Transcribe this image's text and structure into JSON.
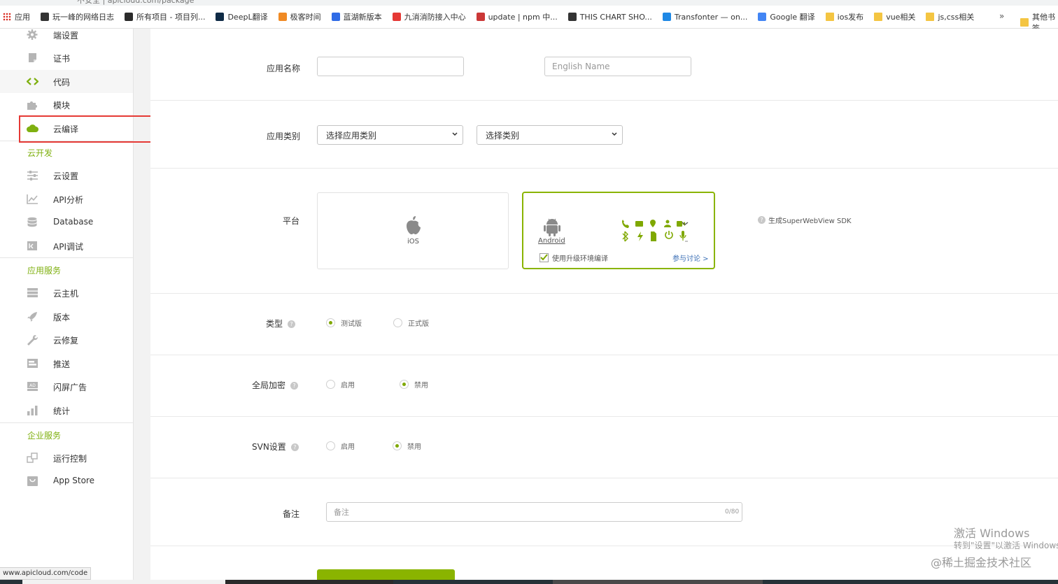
{
  "browser": {
    "url_fragment": "不安全 | apicloud.com/package",
    "bookmarks": [
      {
        "label": "应用",
        "icon": "apps-grid-icon",
        "color": "#d93025"
      },
      {
        "label": "玩一峰的网络日志",
        "icon": "ruanyifeng-favicon",
        "color": "#333333"
      },
      {
        "label": "所有项目 - 项目列...",
        "icon": "project-favicon",
        "color": "#2b2b2b"
      },
      {
        "label": "DeepL翻译",
        "icon": "deepl-favicon",
        "color": "#0f2b46"
      },
      {
        "label": "极客时间",
        "icon": "geektime-favicon",
        "color": "#f08a24"
      },
      {
        "label": "蓝湖新版本",
        "icon": "lanhu-favicon",
        "color": "#2f6be6"
      },
      {
        "label": "九消消防接入中心",
        "icon": "fire-favicon",
        "color": "#e53935"
      },
      {
        "label": "update | npm 中...",
        "icon": "npm-favicon",
        "color": "#cb3837"
      },
      {
        "label": "THIS CHART SHO...",
        "icon": "github-favicon",
        "color": "#333333"
      },
      {
        "label": "Transfonter — on...",
        "icon": "triangle-favicon",
        "color": "#1e88e5"
      },
      {
        "label": "Google 翻译",
        "icon": "google-translate-favicon",
        "color": "#4285f4"
      },
      {
        "label": "ios发布",
        "icon": "folder-icon",
        "color": "#f4c542"
      },
      {
        "label": "vue相关",
        "icon": "folder-icon",
        "color": "#f4c542"
      },
      {
        "label": "js,css相关",
        "icon": "folder-icon",
        "color": "#f4c542"
      }
    ],
    "more": "»",
    "other_bookmarks": "其他书签",
    "status_url": "www.apicloud.com/code"
  },
  "sidebar": {
    "items_top": [
      {
        "label": "端设置",
        "icon": "gear-icon"
      },
      {
        "label": "证书",
        "icon": "certificate-icon"
      },
      {
        "label": "代码",
        "icon": "code-icon"
      },
      {
        "label": "模块",
        "icon": "puzzle-icon"
      },
      {
        "label": "云编译",
        "icon": "cloud-icon"
      }
    ],
    "group_cloud_dev": "云开发",
    "items_cloud_dev": [
      {
        "label": "云设置",
        "icon": "sliders-icon"
      },
      {
        "label": "API分析",
        "icon": "line-chart-icon"
      },
      {
        "label": "Database",
        "icon": "database-icon"
      },
      {
        "label": "API调试",
        "icon": "api-debug-icon"
      }
    ],
    "group_app_services": "应用服务",
    "items_app_services": [
      {
        "label": "云主机",
        "icon": "server-icon"
      },
      {
        "label": "版本",
        "icon": "rocket-icon"
      },
      {
        "label": "云修复",
        "icon": "wrench-icon"
      },
      {
        "label": "推送",
        "icon": "push-icon"
      },
      {
        "label": "闪屏广告",
        "icon": "ad-icon"
      },
      {
        "label": "统计",
        "icon": "bar-chart-icon"
      }
    ],
    "group_enterprise": "企业服务",
    "items_enterprise": [
      {
        "label": "运行控制",
        "icon": "run-control-icon"
      },
      {
        "label": "App Store",
        "icon": "store-icon"
      }
    ],
    "accent_color": "#7fb010",
    "highlight_color": "#e53935"
  },
  "form": {
    "app_name_label": "应用名称",
    "app_name_value": "",
    "english_name_placeholder": "English Name",
    "category_label": "应用类别",
    "category_select_1": "选择应用类别",
    "category_select_2": "选择类别",
    "platform_label": "平台",
    "platform_ios": "iOS",
    "platform_android": "Android",
    "upgrade_env_label": "使用升级环境编译",
    "upgrade_env_checked": true,
    "discuss_link": "参与讨论 >",
    "sdk_link": "生成SuperWebView SDK",
    "type_label": "类型",
    "type_options": [
      "测试版",
      "正式版"
    ],
    "type_selected": "测试版",
    "encrypt_label": "全局加密",
    "encrypt_options": [
      "启用",
      "禁用"
    ],
    "encrypt_selected": "禁用",
    "svn_label": "SVN设置",
    "svn_options": [
      "启用",
      "禁用"
    ],
    "svn_selected": "禁用",
    "remark_label": "备注",
    "remark_placeholder": "备注",
    "remark_counter": "0/80",
    "help_glyph": "?"
  },
  "watermark": {
    "line1": "激活 Windows",
    "line2": "转到\"设置\"以激活 Windows",
    "site": "@稀土掘金技术社区"
  },
  "colors": {
    "android_green": "#7fa800",
    "button_green": "#8ab400",
    "link_blue": "#3b6fb5"
  }
}
